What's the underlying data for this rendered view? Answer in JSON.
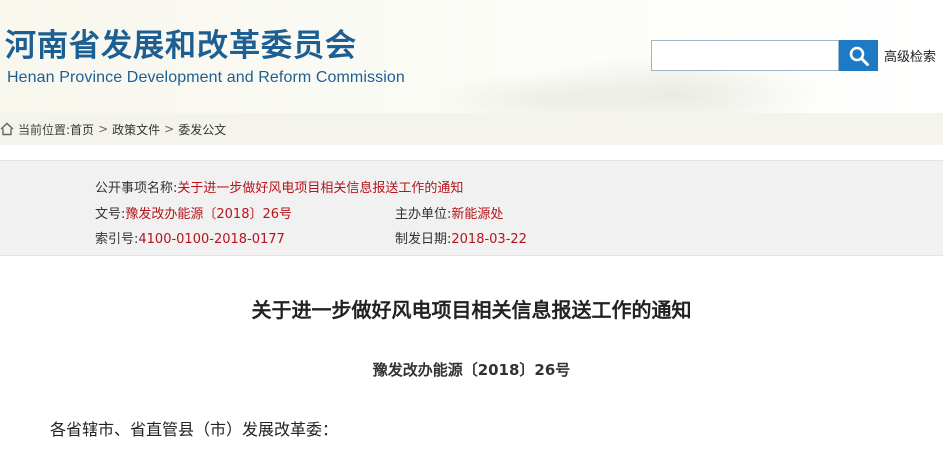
{
  "header": {
    "title_cn": "河南省发展和改革委员会",
    "title_en": "Henan Province Development and Reform Commission",
    "search_placeholder": "",
    "advanced_search_label": "高级检索"
  },
  "breadcrumb": {
    "prefix": "当前位置:",
    "items": [
      "首页",
      "政策文件",
      "委发公文"
    ],
    "separator": ">"
  },
  "info": {
    "subject_label": "公开事项名称:",
    "subject_value": "关于进一步做好风电项目相关信息报送工作的通知",
    "doc_no_label": "文号:",
    "doc_no_value": "豫发改办能源〔2018〕26号",
    "host_label": "主办单位:",
    "host_value": "新能源处",
    "index_label": "索引号:",
    "index_value": "4100-0100-2018-0177",
    "date_label": "制发日期:",
    "date_value": "2018-03-22"
  },
  "document": {
    "title": "关于进一步做好风电项目相关信息报送工作的通知",
    "number": "豫发改办能源〔2018〕26号",
    "salutation": "各省辖市、省直管县（市）发展改革委："
  },
  "icons": {
    "search": "search-icon",
    "home": "home-icon"
  },
  "colors": {
    "brand_blue": "#1d5f93",
    "search_button": "#1f7ac6",
    "value_red": "#b5141b",
    "info_bg": "#f1f1f1"
  }
}
